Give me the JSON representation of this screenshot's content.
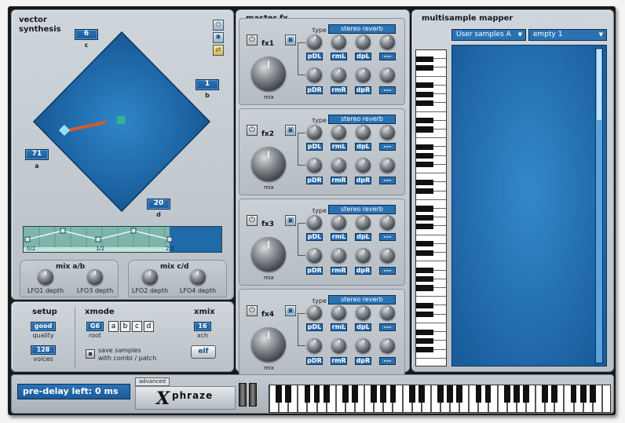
{
  "vector": {
    "title_line1": "vector",
    "title_line2": "synthesis",
    "c_value": "6",
    "c_label": "c",
    "b_value": "1",
    "b_label": "b",
    "a_value": "71",
    "a_label": "a",
    "d_value": "20",
    "d_label": "d",
    "env_points": [
      "0/2",
      "1/2",
      "2/2"
    ],
    "mixab_title": "mix a/b",
    "mixcd_title": "mix c/d",
    "lfo1": "LFO1 depth",
    "lfo3": "LFO3 depth",
    "lfo2": "LFO2 depth",
    "lfo4": "LFO4 depth"
  },
  "setup": {
    "title": "setup",
    "quality_value": "good",
    "quality_label": "quality",
    "voices_value": "128",
    "voices_label": "voices",
    "xmode_title": "xmode",
    "root_value": "G6",
    "root_label": "root",
    "modes": [
      "a",
      "b",
      "c",
      "d"
    ],
    "save_line1": "save samples",
    "save_line2": "with combi / patch",
    "xmix_title": "xmix",
    "xch_value": "16",
    "xch_label": "xch",
    "elf_label": "elf"
  },
  "masterfx": {
    "title": "master fx",
    "units": [
      {
        "name": "fx1",
        "type_label": "type",
        "type_value": "stereo reverb",
        "mix_label": "mix",
        "params_top": [
          "pDL",
          "rmL",
          "dpL",
          "---"
        ],
        "params_bottom": [
          "pDR",
          "rmR",
          "dpR",
          "---"
        ]
      },
      {
        "name": "fx2",
        "type_label": "type",
        "type_value": "stereo reverb",
        "mix_label": "mix",
        "params_top": [
          "pDL",
          "rmL",
          "dpL",
          "---"
        ],
        "params_bottom": [
          "pDR",
          "rmR",
          "dpR",
          "---"
        ]
      },
      {
        "name": "fx3",
        "type_label": "type",
        "type_value": "stereo reverb",
        "mix_label": "mix",
        "params_top": [
          "pDL",
          "rmL",
          "dpL",
          "---"
        ],
        "params_bottom": [
          "pDR",
          "rmR",
          "dpR",
          "---"
        ]
      },
      {
        "name": "fx4",
        "type_label": "type",
        "type_value": "stereo reverb",
        "mix_label": "mix",
        "params_top": [
          "pDL",
          "rmL",
          "dpL",
          "---"
        ],
        "params_bottom": [
          "pDR",
          "rmR",
          "dpR",
          "---"
        ]
      }
    ]
  },
  "mapper": {
    "title": "multisample mapper",
    "samples_select": "User samples A",
    "slot_select": "empty 1"
  },
  "footer": {
    "status": "pre-delay left: 0 ms",
    "advanced_tab": "advanced",
    "logo_x": "X",
    "logo_text": "phraze"
  },
  "colors": {
    "lcd": "#1d5a98",
    "panel": "#c3cad0",
    "pad": "#1f6aa8"
  }
}
